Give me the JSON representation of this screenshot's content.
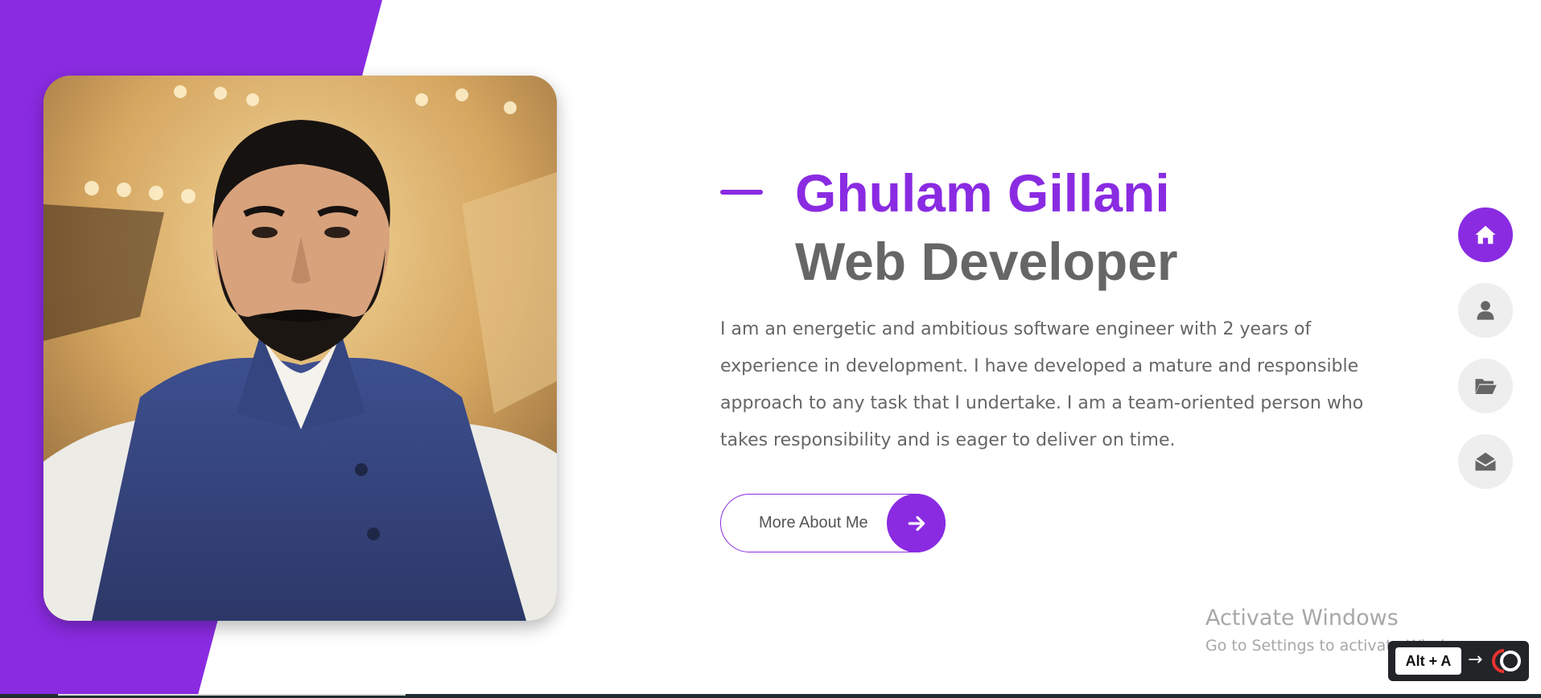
{
  "hero": {
    "name": "Ghulam Gillani",
    "role": "Web Developer",
    "description": "I am an energetic and ambitious software engineer with 2 years of experience in development. I have developed a mature and responsible approach to any task that I undertake. I am a team-oriented person who takes responsibility and is eager to deliver on time.",
    "cta_label": "More About Me",
    "cta_icon": "arrow-right-icon",
    "portrait_alt": "portrait photo"
  },
  "side_nav": {
    "items": [
      {
        "icon": "home-icon",
        "active": true
      },
      {
        "icon": "user-icon",
        "active": false
      },
      {
        "icon": "folder-open-icon",
        "active": false
      },
      {
        "icon": "envelope-open-icon",
        "active": false
      }
    ]
  },
  "watermark": {
    "title": "Activate Windows",
    "subtitle": "Go to Settings to activate Windows."
  },
  "shortcut": {
    "key": "Alt + A",
    "arrow": "→"
  },
  "colors": {
    "accent": "#8a2be2",
    "heading_gray": "#666666",
    "nav_idle": "#eeeeee"
  }
}
